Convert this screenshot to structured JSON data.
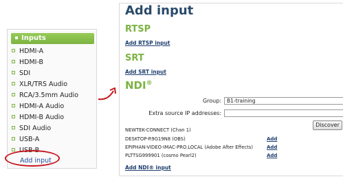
{
  "sidebar": {
    "header": "Inputs",
    "items": [
      {
        "label": "HDMI-A"
      },
      {
        "label": "HDMI-B"
      },
      {
        "label": "SDI"
      },
      {
        "label": "XLR/TRS Audio"
      },
      {
        "label": "RCA/3.5mm Audio"
      },
      {
        "label": "HDMI-A Audio"
      },
      {
        "label": "HDMI-B Audio"
      },
      {
        "label": "SDI Audio"
      },
      {
        "label": "USB-A"
      },
      {
        "label": "USB-B"
      }
    ],
    "add_input": "Add input"
  },
  "panel": {
    "title": "Add input",
    "rtsp": {
      "heading": "RTSP",
      "link": "Add RTSP input"
    },
    "srt": {
      "heading": "SRT",
      "link": "Add SRT input"
    },
    "ndi": {
      "heading": "NDI",
      "heading_mark": "®",
      "group_label": "Group:",
      "group_value": "B1-training",
      "extra_label": "Extra source IP addresses:",
      "extra_value": "",
      "discover_label": "Discover",
      "sources": [
        {
          "name": "NEWTEK-CONNECT (Chan 1)",
          "add": ""
        },
        {
          "name": "DESKTOP-R9G19N8 (OBS)",
          "add": "Add"
        },
        {
          "name": "EPIPHAN-VIDEO-IMAC-PRO.LOCAL (Adobe After Effects)",
          "add": "Add"
        },
        {
          "name": "PLTTSG999901 (cosmo Pearl2)",
          "add": "Add"
        }
      ],
      "add_link": "Add NDI® input"
    }
  },
  "colors": {
    "accent_green": "#7cb342",
    "heading_blue": "#2a4a6b",
    "link_blue": "#1d3f6e",
    "highlight_red": "#c8161d"
  }
}
